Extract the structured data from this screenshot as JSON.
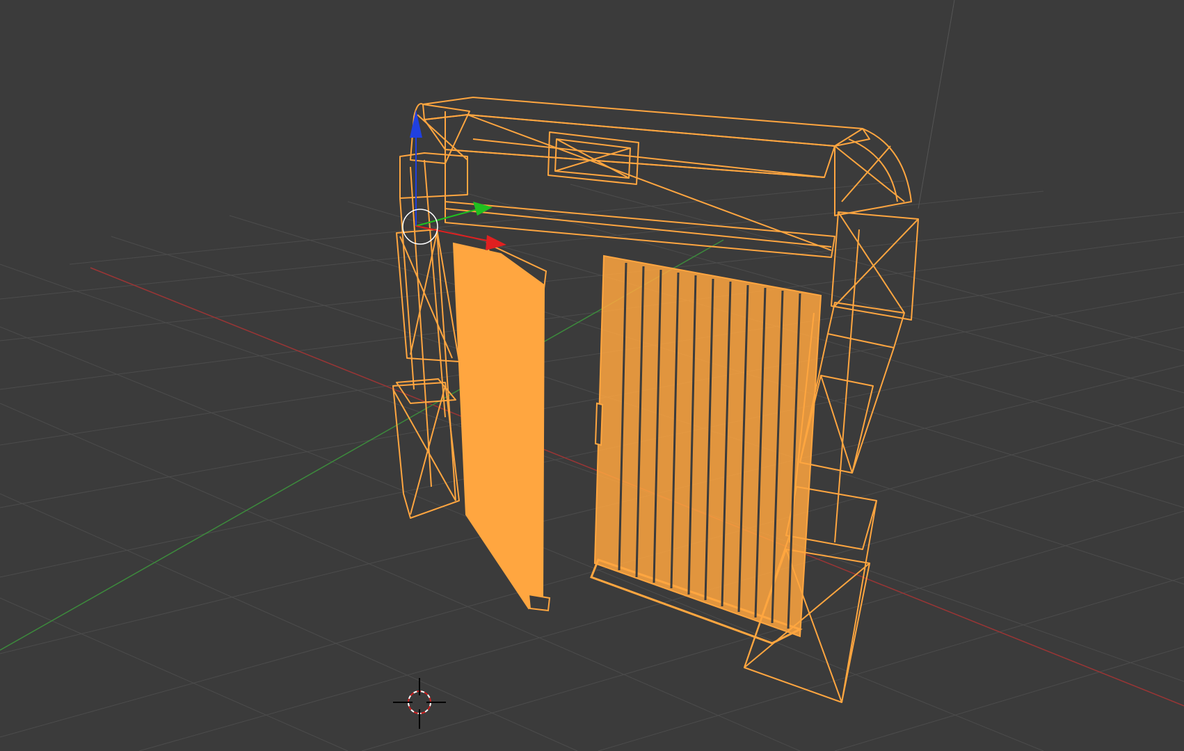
{
  "viewport": {
    "background_color": "#3b3b3b",
    "grid_color": "#4a4a4a",
    "x_axis_color": "#a43a3a",
    "y_axis_color": "#3f8f3f",
    "selection_color": "#ffa640",
    "object_mode": "wireframe"
  },
  "gizmo": {
    "x_color": "#e02020",
    "y_color": "#20c020",
    "z_color": "#2040e0"
  },
  "cursor_3d": {
    "icon": "crosshair-icon"
  }
}
